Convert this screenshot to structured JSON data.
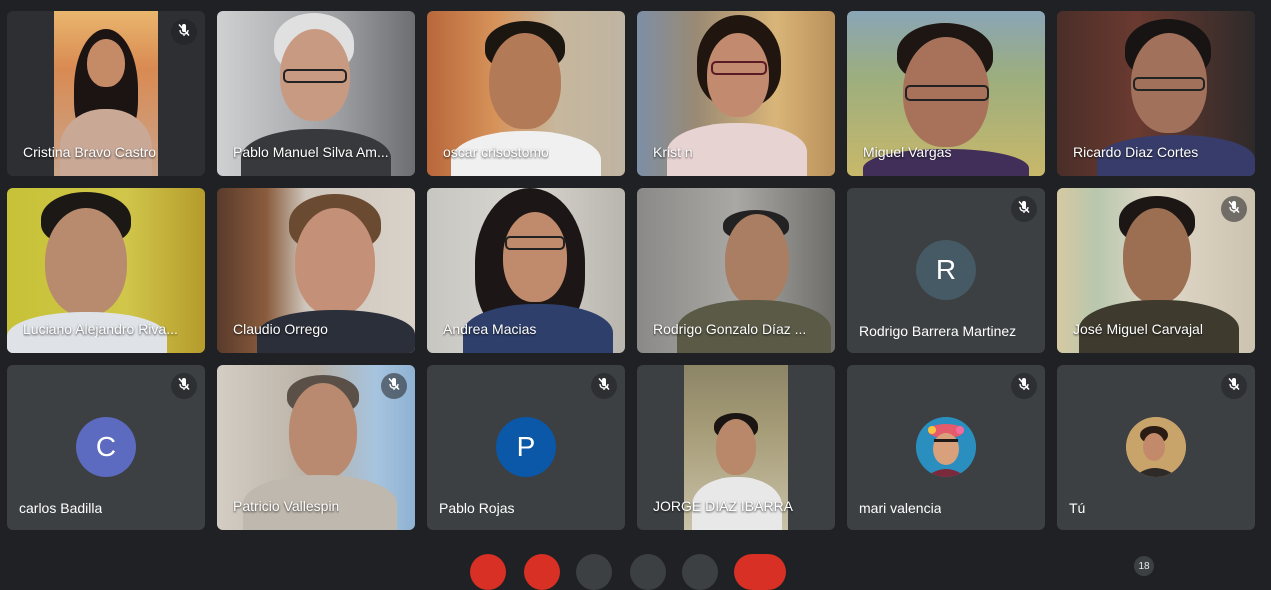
{
  "participants": [
    {
      "name": "Cristina Bravo Castro",
      "muted": true
    },
    {
      "name": "Pablo Manuel Silva Am...",
      "muted": false
    },
    {
      "name": "oscar crisostomo",
      "muted": false
    },
    {
      "name": "Krist n",
      "muted": false
    },
    {
      "name": "Miguel Vargas",
      "muted": false
    },
    {
      "name": "Ricardo Diaz Cortes",
      "muted": false
    },
    {
      "name": "Luciano Alejandro Riva...",
      "muted": false
    },
    {
      "name": "Claudio Orrego",
      "muted": false
    },
    {
      "name": "Andrea Macias",
      "muted": false
    },
    {
      "name": "Rodrigo Gonzalo Díaz ...",
      "muted": false
    },
    {
      "name": "Rodrigo Barrera Martinez",
      "muted": true,
      "initial": "R"
    },
    {
      "name": "José Miguel Carvajal",
      "muted": true
    },
    {
      "name": "carlos Badilla",
      "muted": true,
      "initial": "C"
    },
    {
      "name": "Patricio Vallespin",
      "muted": true
    },
    {
      "name": "Pablo Rojas",
      "muted": true,
      "initial": "P"
    },
    {
      "name": "JORGE DIAZ IBARRA",
      "muted": false
    },
    {
      "name": "mari valencia",
      "muted": true
    },
    {
      "name": "Tú",
      "muted": true
    }
  ],
  "participant_count": "18",
  "colors": {
    "background": "#202124",
    "tile": "#3c4043",
    "avatar_r": "#455a64",
    "avatar_c": "#5c6bc0",
    "avatar_p": "#0b57a8",
    "end_call": "#d93025"
  },
  "icons": {
    "mute": "mic-off-icon"
  }
}
